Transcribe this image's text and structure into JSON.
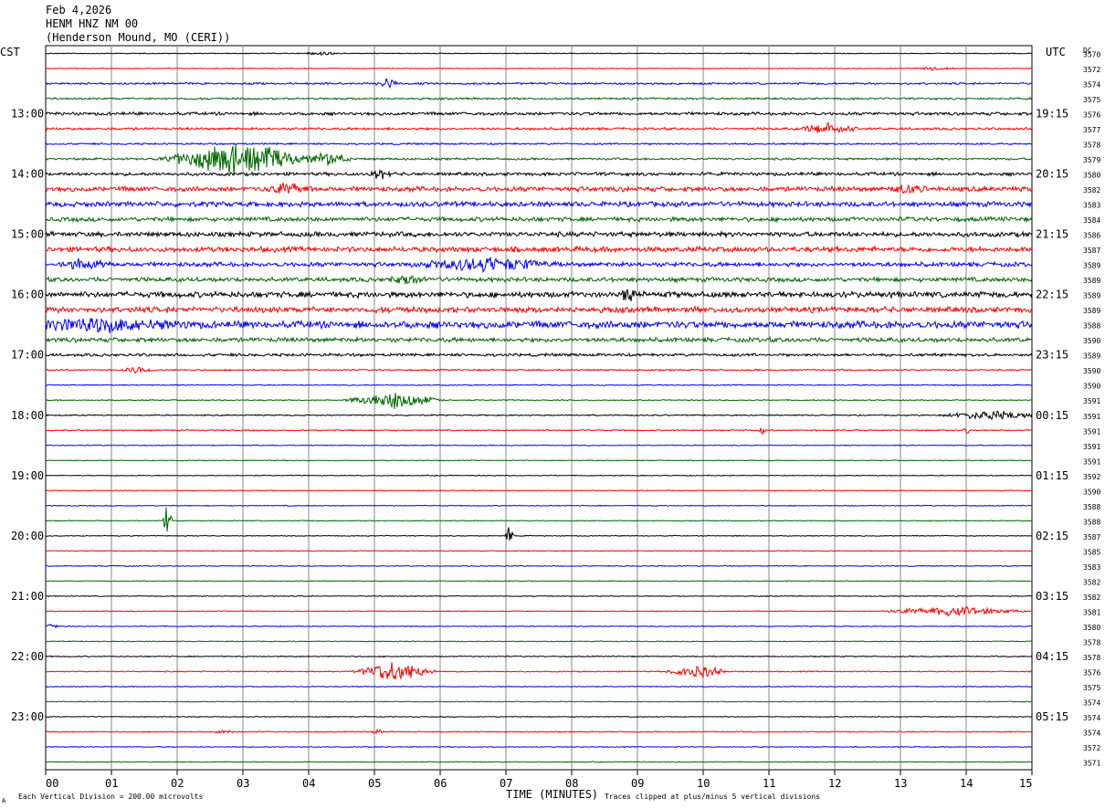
{
  "header": {
    "date": "Feb 4,2026",
    "station": "HENM HNZ NM 00",
    "location": "(Henderson Mound, MO (CERI))"
  },
  "axes": {
    "left_label": "CST",
    "right_label": "UTC",
    "dc_label": "DC",
    "xlabel": "TIME (MINUTES)",
    "x_ticks": [
      "00",
      "01",
      "02",
      "03",
      "04",
      "05",
      "06",
      "07",
      "08",
      "09",
      "10",
      "11",
      "12",
      "13",
      "14",
      "15"
    ]
  },
  "footer": {
    "scale_note": "Each Vertical Division =  200.00 microvolts",
    "clip_note": "Traces clipped at plus/minus 5 vertical divisions",
    "corner_mark": "A"
  },
  "colors": {
    "cycle": [
      "#000000",
      "#ff0000",
      "#0000ff",
      "#006600"
    ],
    "grid": "#888888"
  },
  "chart_data": {
    "type": "helicorder",
    "x_range_minutes": [
      0,
      15
    ],
    "traces_per_hour": 4,
    "cst_hour_labels": [
      "13:00",
      "14:00",
      "15:00",
      "16:00",
      "17:00",
      "18:00",
      "19:00",
      "20:00",
      "21:00",
      "22:00",
      "23:00"
    ],
    "utc_hour_labels": [
      "19:15",
      "20:15",
      "21:15",
      "22:15",
      "23:15",
      "00:15",
      "01:15",
      "02:15",
      "03:15",
      "04:15",
      "05:15"
    ],
    "dc_offsets": [
      "3570",
      "3572",
      "3574",
      "3575",
      "3576",
      "3577",
      "3578",
      "3579",
      "3580",
      "3582",
      "3583",
      "3584",
      "3586",
      "3587",
      "3589",
      "3589",
      "3589",
      "3589",
      "3588",
      "3590",
      "3589",
      "3590",
      "3590",
      "3591",
      "3591",
      "3591",
      "3591",
      "3591",
      "3592",
      "3590",
      "3588",
      "3588",
      "3587",
      "3585",
      "3583",
      "3582",
      "3582",
      "3581",
      "3580",
      "3578",
      "3578",
      "3576",
      "3575",
      "3574",
      "3574",
      "3574",
      "3572",
      "3571"
    ],
    "trace_noise": [
      0.4,
      0.4,
      0.9,
      0.9,
      1.4,
      1.1,
      0.8,
      1.0,
      1.5,
      2.2,
      2.3,
      2.0,
      2.2,
      2.4,
      2.0,
      2.0,
      2.6,
      2.6,
      3.2,
      2.0,
      1.3,
      0.7,
      0.5,
      0.5,
      0.6,
      0.6,
      0.4,
      0.4,
      0.4,
      0.4,
      0.4,
      0.4,
      0.4,
      0.4,
      0.4,
      0.4,
      0.4,
      0.4,
      0.4,
      0.4,
      0.5,
      0.5,
      0.4,
      0.4,
      0.4,
      0.5,
      0.4,
      0.4
    ],
    "events": [
      {
        "trace": 0,
        "minute": 4.2,
        "amp": 2,
        "dur": 0.3
      },
      {
        "trace": 1,
        "minute": 13.5,
        "amp": 2,
        "dur": 0.4
      },
      {
        "trace": 2,
        "minute": 5.2,
        "amp": 6,
        "dur": 0.2
      },
      {
        "trace": 5,
        "minute": 11.9,
        "amp": 7,
        "dur": 0.5
      },
      {
        "trace": 7,
        "minute": 2.9,
        "amp": 22,
        "dur": 1.2
      },
      {
        "trace": 7,
        "minute": 4.3,
        "amp": 9,
        "dur": 0.4
      },
      {
        "trace": 8,
        "minute": 5.1,
        "amp": 6,
        "dur": 0.2
      },
      {
        "trace": 9,
        "minute": 3.7,
        "amp": 7,
        "dur": 0.4
      },
      {
        "trace": 9,
        "minute": 13.1,
        "amp": 6,
        "dur": 0.3
      },
      {
        "trace": 14,
        "minute": 0.6,
        "amp": 7,
        "dur": 0.4
      },
      {
        "trace": 14,
        "minute": 6.7,
        "amp": 8,
        "dur": 1.2
      },
      {
        "trace": 15,
        "minute": 5.5,
        "amp": 5,
        "dur": 0.3
      },
      {
        "trace": 16,
        "minute": 8.9,
        "amp": 8,
        "dur": 0.2
      },
      {
        "trace": 18,
        "minute": 0.8,
        "amp": 7,
        "dur": 1.5
      },
      {
        "trace": 21,
        "minute": 1.4,
        "amp": 4,
        "dur": 0.3
      },
      {
        "trace": 23,
        "minute": 5.3,
        "amp": 11,
        "dur": 0.8
      },
      {
        "trace": 24,
        "minute": 14.4,
        "amp": 6,
        "dur": 0.9
      },
      {
        "trace": 25,
        "minute": 10.9,
        "amp": 6,
        "dur": 0.05
      },
      {
        "trace": 25,
        "minute": 14.0,
        "amp": 12,
        "dur": 0.05
      },
      {
        "trace": 31,
        "minute": 1.85,
        "amp": 22,
        "dur": 0.08
      },
      {
        "trace": 32,
        "minute": 7.05,
        "amp": 11,
        "dur": 0.08
      },
      {
        "trace": 37,
        "minute": 13.8,
        "amp": 6,
        "dur": 1.2
      },
      {
        "trace": 38,
        "minute": 0.1,
        "amp": 4,
        "dur": 0.1
      },
      {
        "trace": 41,
        "minute": 5.3,
        "amp": 13,
        "dur": 0.7
      },
      {
        "trace": 41,
        "minute": 9.9,
        "amp": 9,
        "dur": 0.5
      },
      {
        "trace": 45,
        "minute": 2.7,
        "amp": 2,
        "dur": 0.2
      },
      {
        "trace": 45,
        "minute": 5.05,
        "amp": 3,
        "dur": 0.1
      }
    ]
  }
}
